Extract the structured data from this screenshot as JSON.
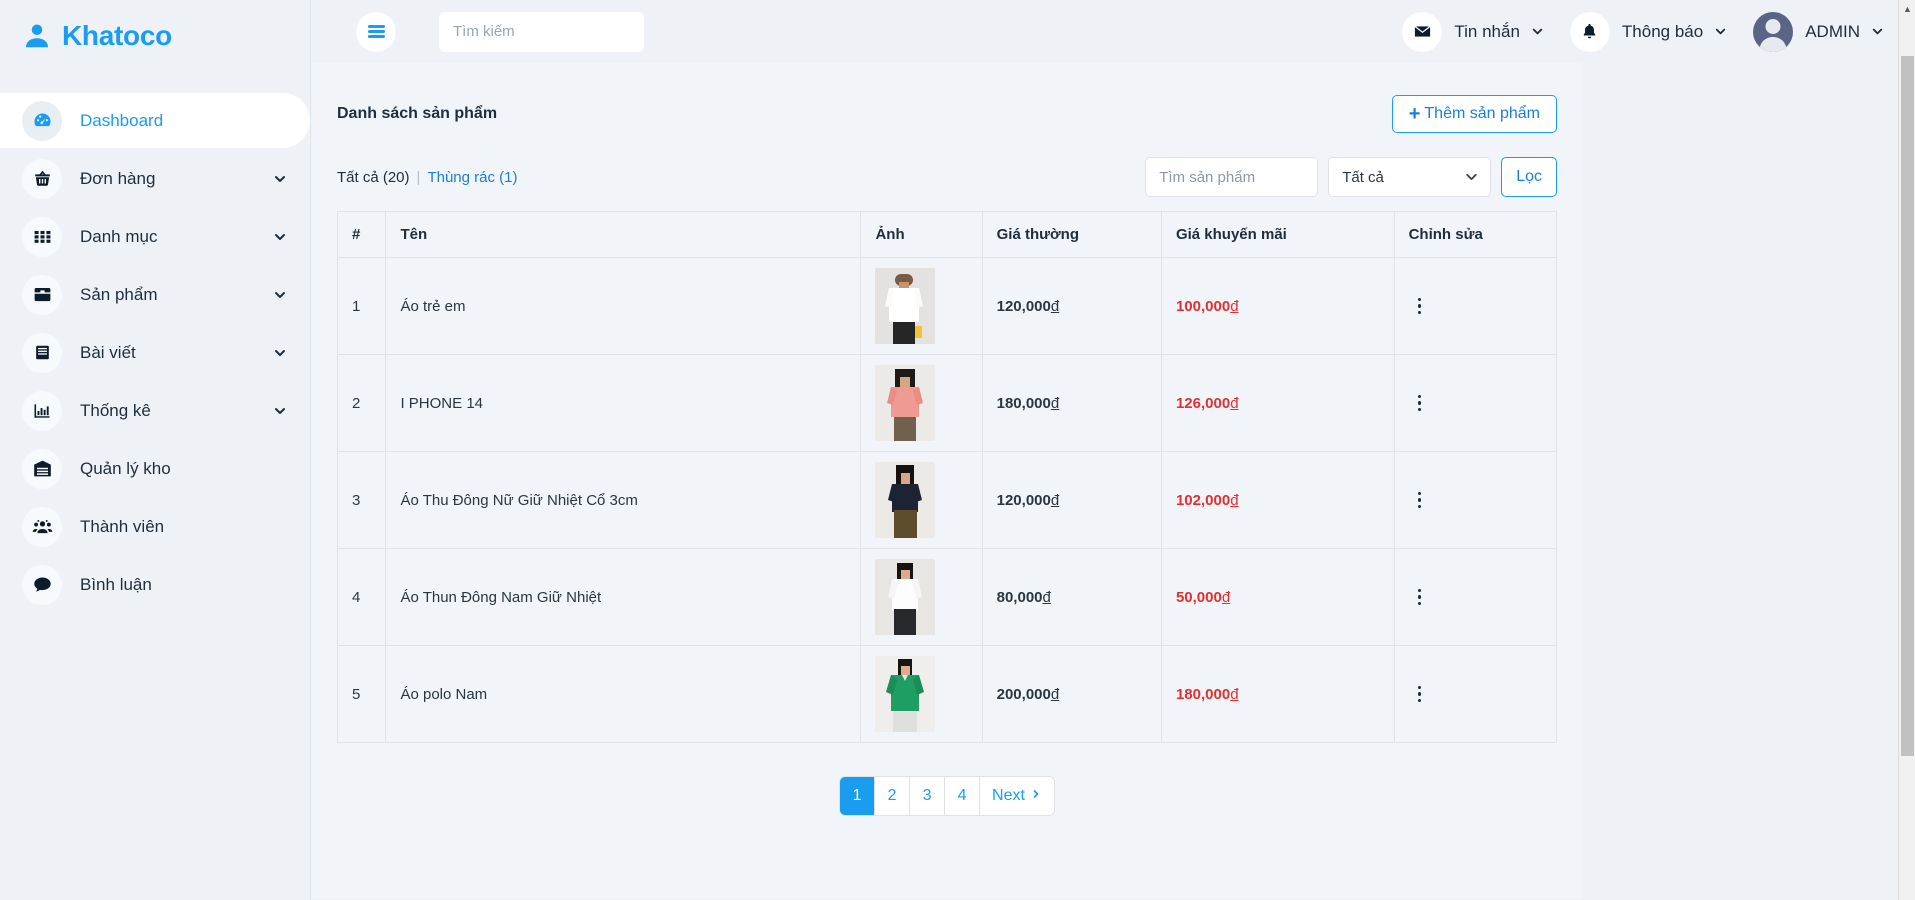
{
  "brand": {
    "name": "Khatoco",
    "icon": "user-icon",
    "color": "#1a9cf0"
  },
  "sidebar": {
    "items": [
      {
        "label": "Dashboard",
        "icon": "dashboard-icon",
        "active": true,
        "caret": false
      },
      {
        "label": "Đơn hàng",
        "icon": "basket-icon",
        "active": false,
        "caret": true
      },
      {
        "label": "Danh mục",
        "icon": "grid-icon",
        "active": false,
        "caret": true
      },
      {
        "label": "Sản phẩm",
        "icon": "box-icon",
        "active": false,
        "caret": true
      },
      {
        "label": "Bài viết",
        "icon": "article-icon",
        "active": false,
        "caret": true
      },
      {
        "label": "Thống kê",
        "icon": "chart-icon",
        "active": false,
        "caret": true
      },
      {
        "label": "Quản lý kho",
        "icon": "warehouse-icon",
        "active": false,
        "caret": false
      },
      {
        "label": "Thành viên",
        "icon": "users-icon",
        "active": false,
        "caret": false
      },
      {
        "label": "Bình luận",
        "icon": "comment-icon",
        "active": false,
        "caret": false
      }
    ]
  },
  "topbar": {
    "menu_toggle": "hamburger-icon",
    "search_placeholder": "Tìm kiếm",
    "search_value": "",
    "messages": {
      "label": "Tin nhắn",
      "icon": "envelope-icon"
    },
    "notifications": {
      "label": "Thông báo",
      "icon": "bell-icon"
    },
    "user": {
      "label": "ADMIN",
      "icon": "avatar"
    }
  },
  "page": {
    "title": "Danh sách sản phẩm",
    "add_button": "Thêm sản phẩm",
    "tab_all": "Tất cả (20)",
    "tab_sep": "|",
    "tab_trash": "Thùng rác (1)",
    "search_placeholder": "Tìm sản phẩm",
    "search_value": "",
    "select_value": "Tất cả",
    "select_options": [
      "Tất cả"
    ],
    "filter_button": "Lọc"
  },
  "table": {
    "columns": [
      "#",
      "Tên",
      "Ảnh",
      "Giá thường",
      "Giá khuyến mãi",
      "Chỉnh sửa"
    ],
    "rows": [
      {
        "idx": "1",
        "name": "Áo trẻ em",
        "image": "product-thumbnail-white-longsleeve",
        "price": "120,000",
        "currency": "đ",
        "sale": "100,000",
        "sale_currency": "đ",
        "edit": "more-actions-icon"
      },
      {
        "idx": "2",
        "name": "I PHONE 14",
        "image": "product-thumbnail-pink-top",
        "price": "180,000",
        "currency": "đ",
        "sale": "126,000",
        "sale_currency": "đ",
        "edit": "more-actions-icon"
      },
      {
        "idx": "3",
        "name": "Áo Thu Đông Nữ Giữ Nhiệt Cổ 3cm",
        "image": "product-thumbnail-navy-top",
        "price": "120,000",
        "currency": "đ",
        "sale": "102,000",
        "sale_currency": "đ",
        "edit": "more-actions-icon"
      },
      {
        "idx": "4",
        "name": "Áo Thun Đông Nam Giữ Nhiệt",
        "image": "product-thumbnail-white-shirt-man",
        "price": "80,000",
        "currency": "đ",
        "sale": "50,000",
        "sale_currency": "đ",
        "edit": "more-actions-icon"
      },
      {
        "idx": "5",
        "name": "Áo polo Nam",
        "image": "product-thumbnail-green-polo",
        "price": "200,000",
        "currency": "đ",
        "sale": "180,000",
        "sale_currency": "đ",
        "edit": "more-actions-icon"
      }
    ]
  },
  "pagination": {
    "pages": [
      "1",
      "2",
      "3",
      "4"
    ],
    "current": "1",
    "next_label": "Next"
  },
  "colors": {
    "accent": "#1a9cf0",
    "link": "#1a7fd4",
    "sale_price": "#e03131",
    "page_bg": "#eef2f6",
    "card_bg": "#f1f4f8"
  }
}
